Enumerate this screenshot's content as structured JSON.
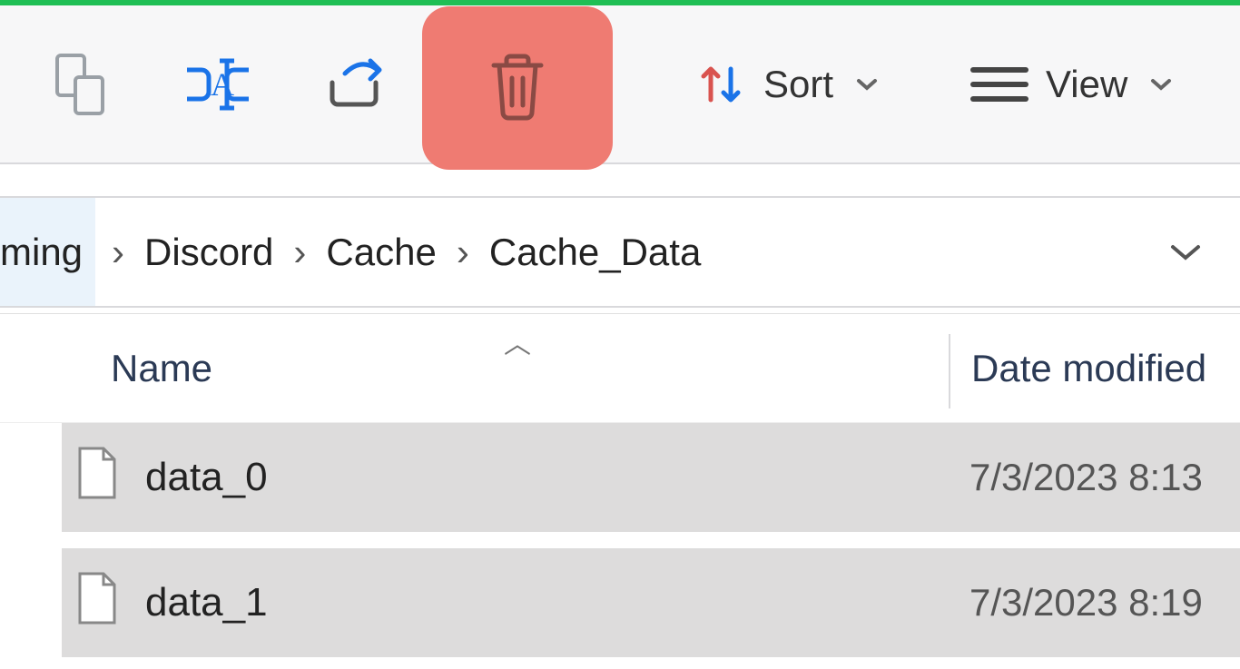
{
  "toolbar": {
    "sort_label": "Sort",
    "view_label": "View"
  },
  "breadcrumb": {
    "partial_first": "ming",
    "items": [
      "Discord",
      "Cache",
      "Cache_Data"
    ]
  },
  "columns": {
    "name": "Name",
    "date": "Date modified"
  },
  "files": [
    {
      "name": "data_0",
      "modified": "7/3/2023 8:13 "
    },
    {
      "name": "data_1",
      "modified": "7/3/2023 8:19 "
    }
  ]
}
